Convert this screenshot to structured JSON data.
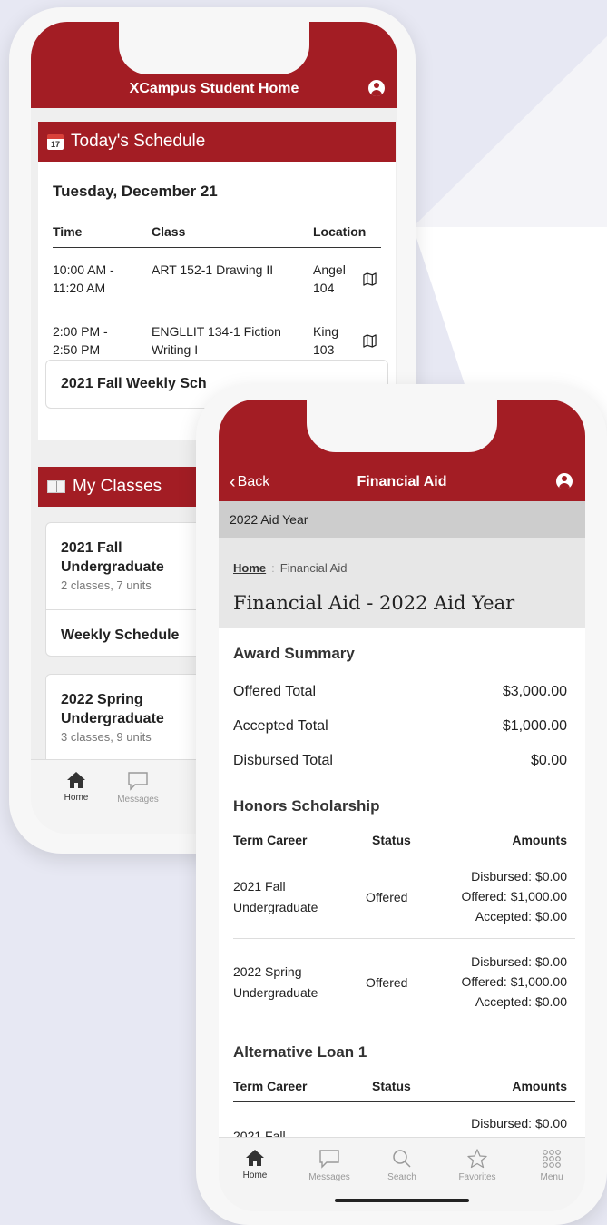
{
  "phone1": {
    "header_title": "XCampus Student Home",
    "schedule": {
      "section_title": "Today's Schedule",
      "calendar_day": "17",
      "date": "Tuesday, December 21",
      "col_time": "Time",
      "col_class": "Class",
      "col_location": "Location",
      "rows": [
        {
          "time_line1": "10:00 AM -",
          "time_line2": "11:20 AM",
          "class": "ART 152-1 Drawing II",
          "class_line2": "",
          "loc_line1": "Angel",
          "loc_line2": "104"
        },
        {
          "time_line1": "2:00 PM -",
          "time_line2": "2:50 PM",
          "class": "ENGLLIT 134-1 Fiction",
          "class_line2": "Writing I",
          "loc_line1": "King",
          "loc_line2": "103"
        }
      ],
      "weekly_button": "2021 Fall Weekly Sch"
    },
    "classes": {
      "section_title": "My Classes",
      "term1_line1": "2021 Fall",
      "term1_line2": "Undergraduate",
      "term1_sub": "2 classes, 7 units",
      "weekly_schedule": "Weekly Schedule",
      "term2_line1": "2022 Spring",
      "term2_line2": "Undergraduate",
      "term2_sub": "3 classes, 9 units"
    },
    "tabs": {
      "home": "Home",
      "messages": "Messages"
    }
  },
  "phone2": {
    "back_label": "Back",
    "header_title": "Financial Aid",
    "aid_year": "2022 Aid Year",
    "breadcrumb_home": "Home",
    "breadcrumb_sep": ":",
    "breadcrumb_current": "Financial Aid",
    "page_title": "Financial Aid - 2022 Aid Year",
    "award_summary": {
      "title": "Award Summary",
      "offered_label": "Offered Total",
      "offered_value": "$3,000.00",
      "accepted_label": "Accepted Total",
      "accepted_value": "$1,000.00",
      "disbursed_label": "Disbursed Total",
      "disbursed_value": "$0.00"
    },
    "honors": {
      "title": "Honors Scholarship",
      "col_term": "Term Career",
      "col_status": "Status",
      "col_amounts": "Amounts",
      "rows": [
        {
          "term_line1": "2021 Fall",
          "term_line2": "Undergraduate",
          "status": "Offered",
          "disbursed": "Disbursed: $0.00",
          "offered": "Offered: $1,000.00",
          "accepted": "Accepted: $0.00"
        },
        {
          "term_line1": "2022 Spring",
          "term_line2": "Undergraduate",
          "status": "Offered",
          "disbursed": "Disbursed: $0.00",
          "offered": "Offered: $1,000.00",
          "accepted": "Accepted: $0.00"
        }
      ]
    },
    "loan": {
      "title": "Alternative Loan 1",
      "col_term": "Term Career",
      "col_status": "Status",
      "col_amounts": "Amounts",
      "partial_term": "2021 Fall",
      "partial_disbursed": "Disbursed: $0.00"
    },
    "tabs": {
      "home": "Home",
      "messages": "Messages",
      "search": "Search",
      "favorites": "Favorites",
      "menu": "Menu"
    }
  },
  "colors": {
    "brand_red": "#a31d24",
    "background": "#e7e8f3"
  }
}
